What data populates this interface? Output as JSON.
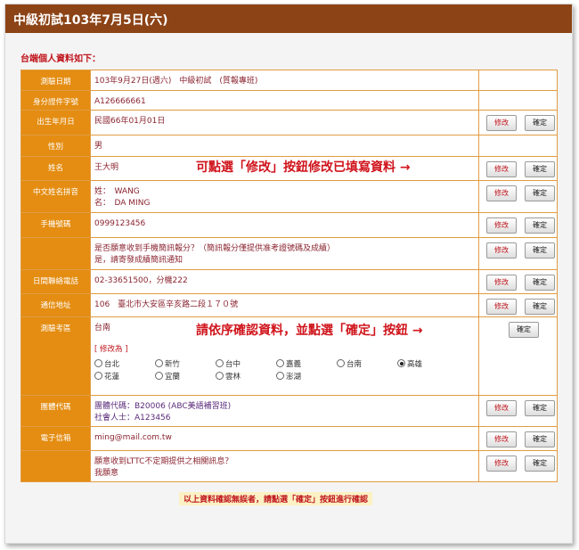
{
  "window": {
    "title": "中級初試103年7月5日(六)"
  },
  "intro": "台端個人資料如下：",
  "buttons": {
    "edit": "修改",
    "confirm": "確定"
  },
  "rows": [
    {
      "label": "測驗日期",
      "value": "103年9月27日(週六)　中級初試　(質報專班)"
    },
    {
      "label": "身分證件字號",
      "value": "A126666661"
    },
    {
      "label": "出生年月日",
      "value": "民國66年01月01日"
    },
    {
      "label": "性別",
      "value": "男"
    },
    {
      "label": "姓名",
      "value": "王大明"
    },
    {
      "label": "中文姓名拼音",
      "line1": "姓：　WANG",
      "line2": "名：　DA MING"
    },
    {
      "label": "手機號碼",
      "value": "0999123456"
    },
    {
      "label": "",
      "line1": "是否願意收到手機簡訊報分？（簡訊報分僅提供准考證號碼及成績）",
      "line2": "是，請寄發成績簡訊通知"
    },
    {
      "label": "日間聯絡電話",
      "value": "02-33651500，分機222"
    },
    {
      "label": "通信地址",
      "value": "106　臺北市大安區辛亥路二段１７０號"
    },
    {
      "label": "測驗考區",
      "value": "台南",
      "change_label": "[ 修改為 ]"
    },
    {
      "label": "團體代碼",
      "line1": "團體代碼：B20006 (ABC美語補習班)",
      "line2": "社會人士：A123456"
    },
    {
      "label": "電子信箱",
      "value": "ming@mail.com.tw"
    },
    {
      "label": "",
      "line1": "願意收到LTTC不定期提供之相關訊息？",
      "line2": "我願意"
    }
  ],
  "regions": {
    "options": [
      "台北",
      "新竹",
      "台中",
      "嘉義",
      "台南",
      "高雄",
      "花蓮",
      "宜蘭",
      "雲林",
      "澎湖"
    ],
    "selected": "高雄"
  },
  "annotations": {
    "edit_hint": "可點選「修改」按鈕修改已填寫資料 →",
    "confirm_hint": "請依序確認資料，並點選「確定」按鈕 →"
  },
  "footer_note": "以上資料確認無誤者，請點選「確定」按鈕進行確認",
  "colors": {
    "title_bar": "#8c4316",
    "label_bg": "#e48d12",
    "accent_red": "#d0141c"
  }
}
